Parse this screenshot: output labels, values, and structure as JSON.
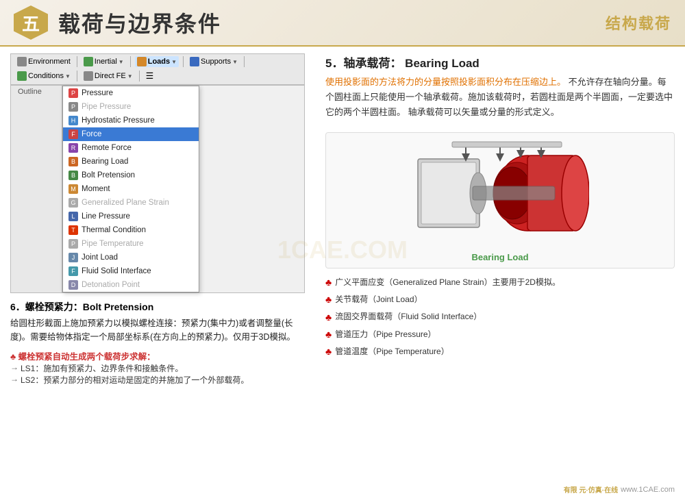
{
  "header": {
    "badge": "五",
    "title": "载荷与边界条件",
    "subtitle": "结构载荷"
  },
  "toolbar": {
    "items": [
      {
        "label": "Environment",
        "icon": "env-icon"
      },
      {
        "label": "Inertial",
        "icon": "inertial-icon",
        "dropdown": true
      },
      {
        "label": "Loads",
        "icon": "loads-icon",
        "dropdown": true,
        "active": true
      },
      {
        "label": "Supports",
        "icon": "supports-icon",
        "dropdown": true
      },
      {
        "label": "Conditions",
        "icon": "conditions-icon",
        "dropdown": true
      },
      {
        "label": "Direct FE",
        "icon": "directfe-icon",
        "dropdown": true
      }
    ]
  },
  "outline": {
    "label": "Outline"
  },
  "menu": {
    "items": [
      {
        "label": "Pressure",
        "icon": "pressure",
        "state": "normal"
      },
      {
        "label": "Pipe Pressure",
        "icon": "pipe",
        "state": "disabled"
      },
      {
        "label": "Hydrostatic Pressure",
        "icon": "hydro",
        "state": "normal"
      },
      {
        "label": "Force",
        "icon": "force",
        "state": "selected"
      },
      {
        "label": "Remote Force",
        "icon": "remote",
        "state": "normal"
      },
      {
        "label": "Bearing Load",
        "icon": "bearing",
        "state": "normal"
      },
      {
        "label": "Bolt Pretension",
        "icon": "bolt",
        "state": "normal"
      },
      {
        "label": "Moment",
        "icon": "moment",
        "state": "normal"
      },
      {
        "label": "Generalized Plane Strain",
        "icon": "gps",
        "state": "disabled"
      },
      {
        "label": "Line Pressure",
        "icon": "line",
        "state": "normal"
      },
      {
        "label": "Thermal Condition",
        "icon": "thermal",
        "state": "normal"
      },
      {
        "label": "Pipe Temperature",
        "icon": "pipetemp",
        "state": "disabled"
      },
      {
        "label": "Joint Load",
        "icon": "joint",
        "state": "normal"
      },
      {
        "label": "Fluid Solid Interface",
        "icon": "fluid",
        "state": "normal"
      },
      {
        "label": "Detonation Point",
        "icon": "detonation",
        "state": "disabled"
      }
    ]
  },
  "section5": {
    "title": "5．轴承载荷：  Bearing Load",
    "body_line1": "使用投影面的方法将力的分量按照投影面",
    "body_line2": "积分布在压缩边上。",
    "body_line3": "不允许存在轴向分量。每",
    "body_line4": "个圆柱面上只能使用一个轴承载荷。施加该载",
    "body_line5": "荷时，若圆柱面是两个半圆面，一定要选中它",
    "body_line6": "的两个半圆柱面。 轴承载荷可以矢量或分量的",
    "body_line7": "形式定义。",
    "highlight": "使用投影面的方法将力的分量按照投影面积分布在压缩边上。",
    "bearing_label": "Bearing Load"
  },
  "section6": {
    "title": "6．螺栓预紧力：Bolt Pretension",
    "body": "给圆柱形截面上施加预紧力以模拟螺栓连接：预紧力(集中力)或者调整量(长度)。需要给物体指定一个局部坐标系(在方向上的预紧力)。仅用于3D模拟。",
    "sub_title": "♣ 螺栓预紧自动生成两个载荷步求解：",
    "ls1_arrow": "→",
    "ls1": "LS1：施加有预紧力、边界条件和接触条件。",
    "ls2_arrow": "→",
    "ls2": "LS2：预紧力部分的相对运动是固定的并施加了一个外部载荷。"
  },
  "bottom_items": [
    {
      "text": "广义平面应变（Generalized Plane Strain）主要用于2D模拟。"
    },
    {
      "text": "关节载荷（Joint Load）"
    },
    {
      "text": "流固交界面载荷（Fluid Solid Interface）"
    },
    {
      "text": "管道压力（Pipe Pressure）"
    },
    {
      "text": "管道温度（Pipe Temperature）"
    }
  ],
  "watermark": "1CAE.COM",
  "footer": {
    "logo": "有限元·仿真·在线",
    "url": "www.1CAE.com"
  }
}
